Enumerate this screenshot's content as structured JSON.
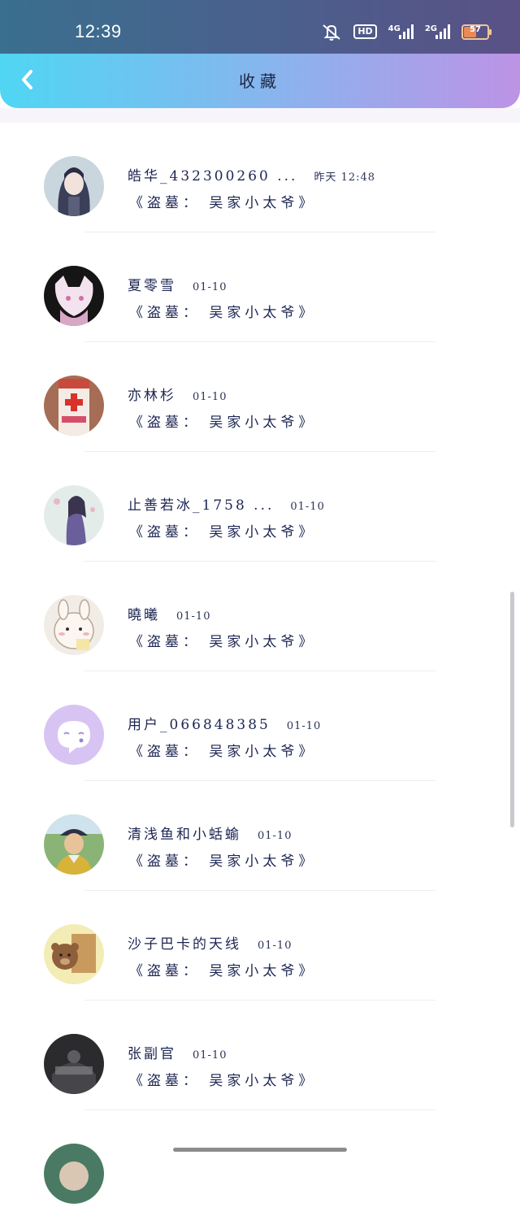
{
  "status_bar": {
    "time": "12:39",
    "hd_label": "HD",
    "net_4g": "4G",
    "net_2g": "2G",
    "battery": "57"
  },
  "header": {
    "title": "收藏"
  },
  "items": [
    {
      "name": "皓华_432300260 ...",
      "time": "昨天 12:48",
      "content": "《盗墓： 吴家小太爷》"
    },
    {
      "name": "夏零雪",
      "time": "01-10",
      "content": "《盗墓： 吴家小太爷》"
    },
    {
      "name": "亦林杉",
      "time": "01-10",
      "content": "《盗墓： 吴家小太爷》"
    },
    {
      "name": "止善若冰_1758 ...",
      "time": "01-10",
      "content": "《盗墓： 吴家小太爷》"
    },
    {
      "name": "曉曦",
      "time": "01-10",
      "content": "《盗墓： 吴家小太爷》"
    },
    {
      "name": "用户_066848385",
      "time": "01-10",
      "content": "《盗墓： 吴家小太爷》"
    },
    {
      "name": "清浅鱼和小蛞蝓",
      "time": "01-10",
      "content": "《盗墓： 吴家小太爷》"
    },
    {
      "name": "沙子巴卡的天线",
      "time": "01-10",
      "content": "《盗墓： 吴家小太爷》"
    },
    {
      "name": "张副官",
      "time": "01-10",
      "content": "《盗墓： 吴家小太爷》"
    }
  ],
  "colors": {
    "header_start": "#4fd6f3",
    "header_end": "#bd93e6",
    "text": "#1c2552"
  }
}
